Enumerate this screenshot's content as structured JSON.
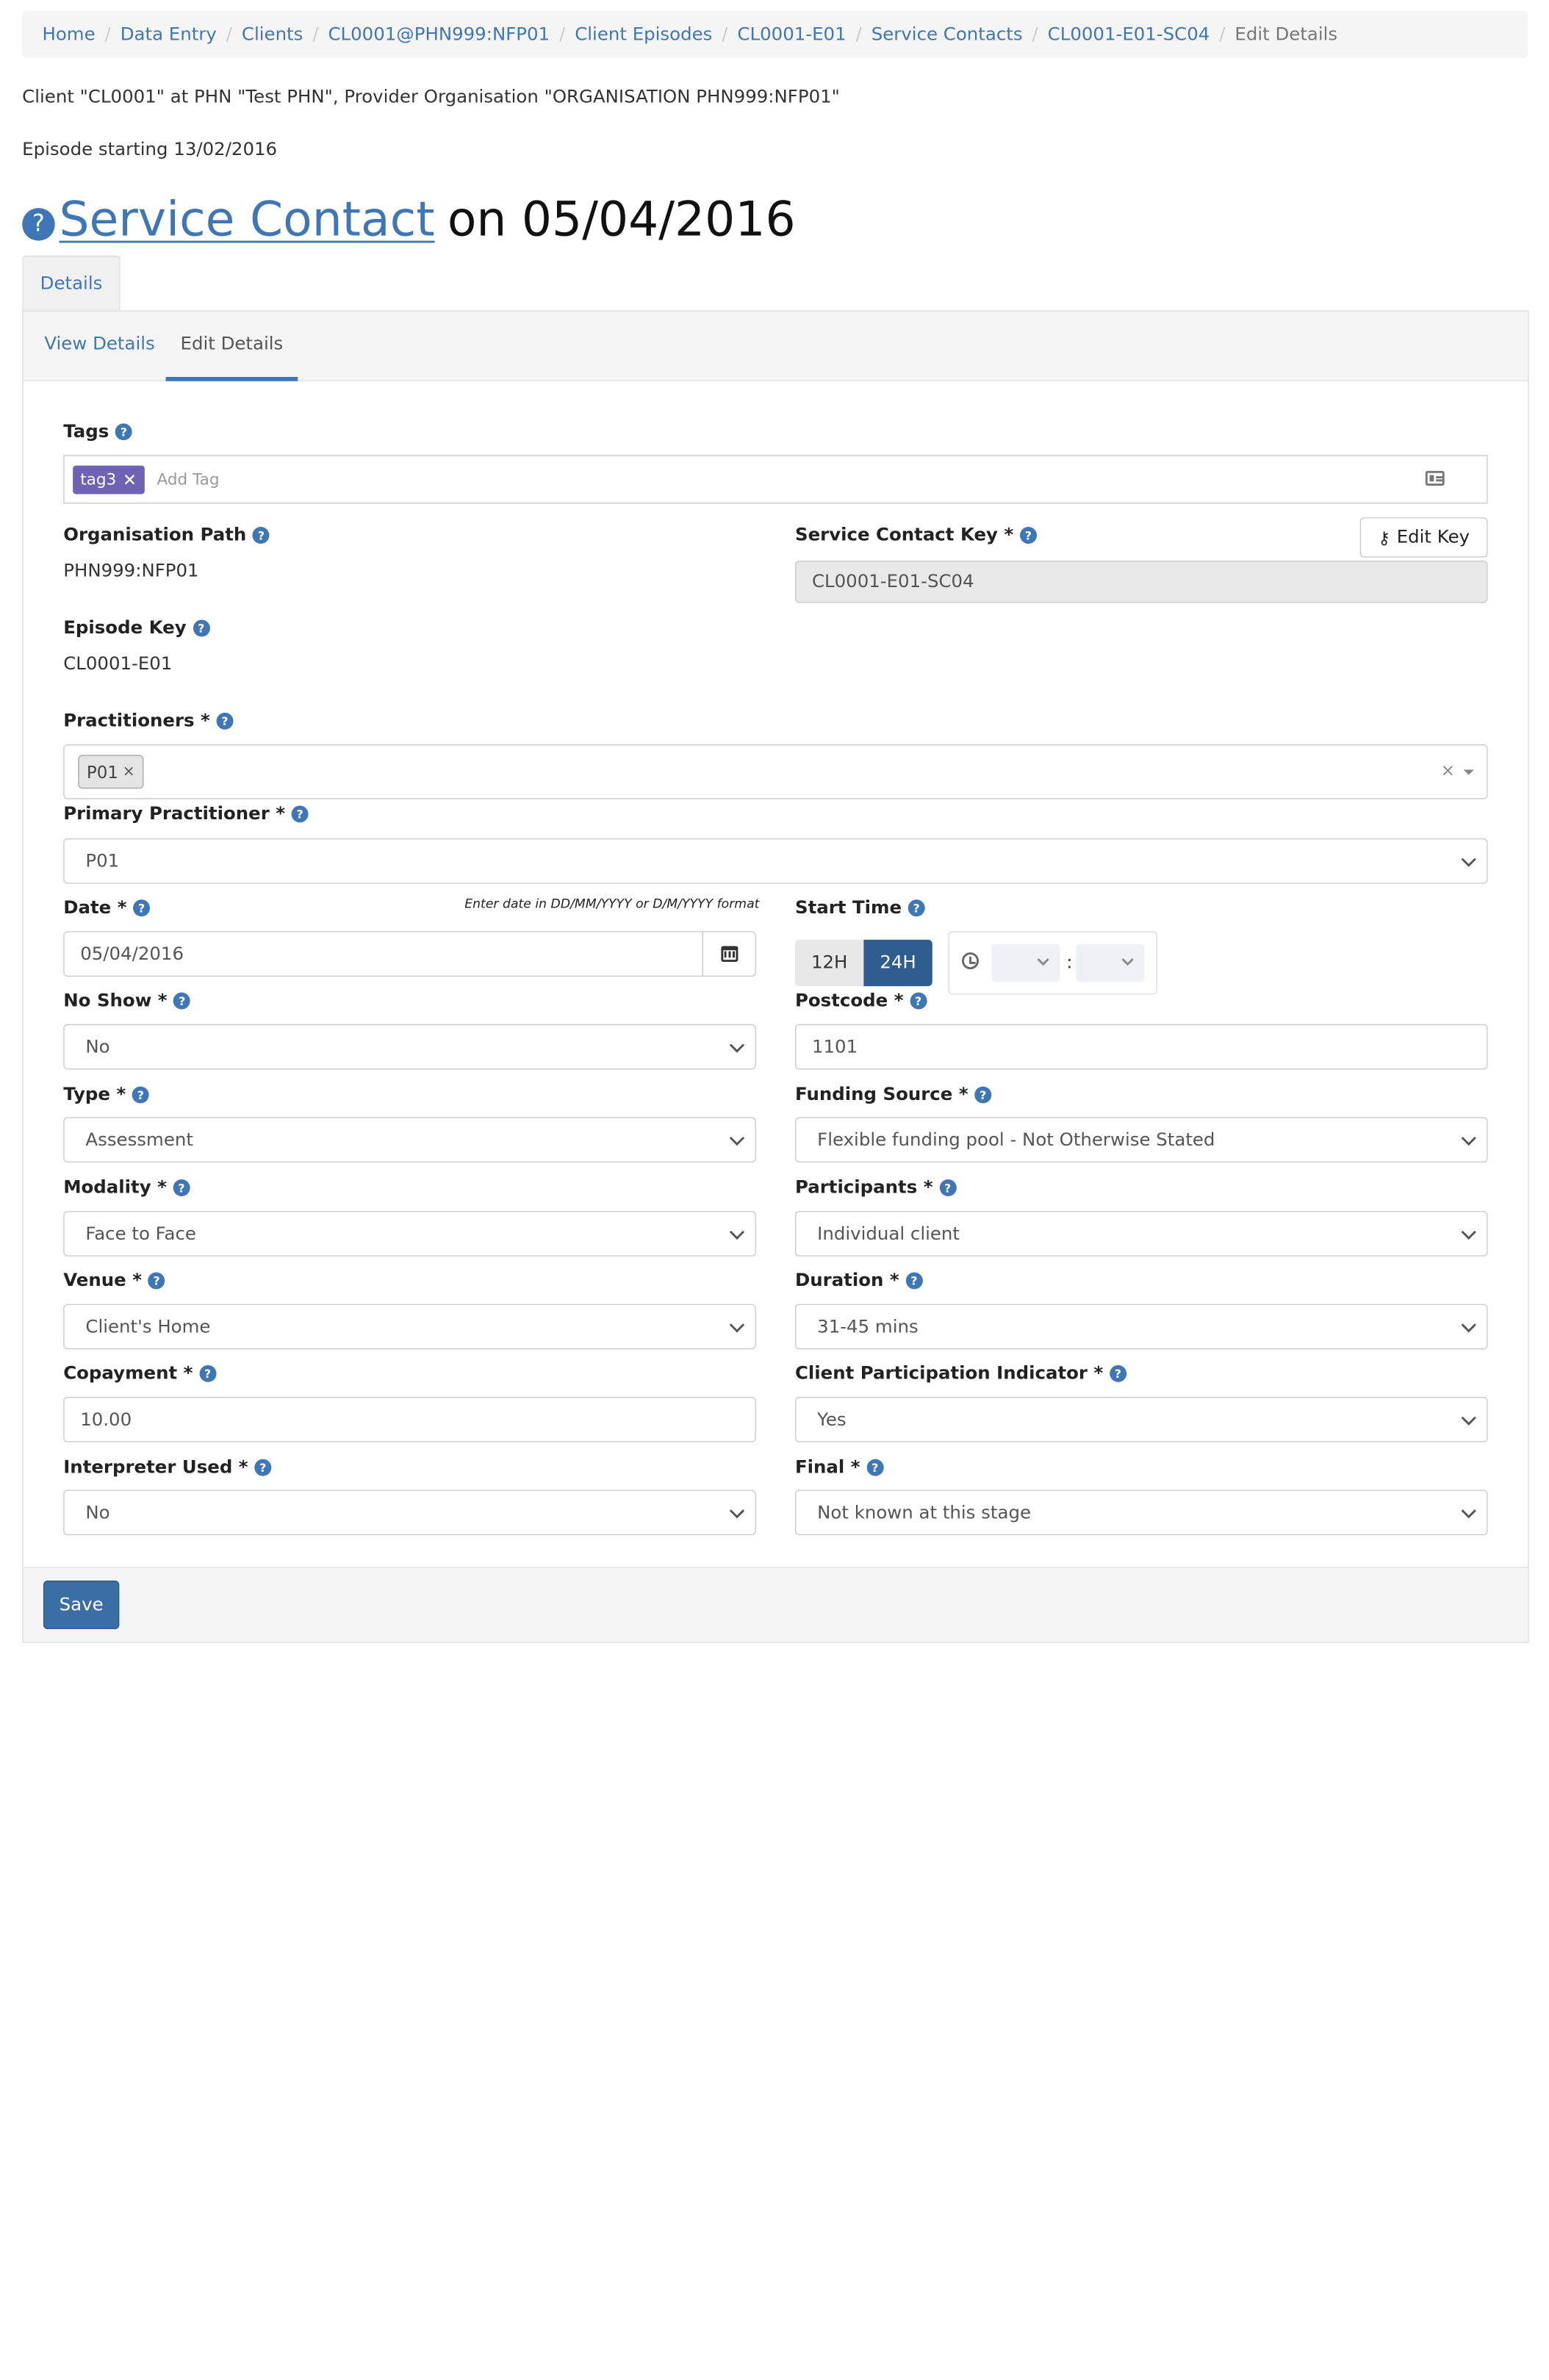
{
  "breadcrumb": [
    "Home",
    "Data Entry",
    "Clients",
    "CL0001@PHN999:NFP01",
    "Client Episodes",
    "CL0001-E01",
    "Service Contacts",
    "CL0001-E01-SC04",
    "Edit Details"
  ],
  "client_line": "Client \"CL0001\" at PHN \"Test PHN\", Provider Organisation \"ORGANISATION PHN999:NFP01\"",
  "episode_line": "Episode starting 13/02/2016",
  "title": {
    "link": "Service Contact",
    "rest": "on 05/04/2016",
    "help": "?"
  },
  "tabs": {
    "outer": "Details",
    "view": "View Details",
    "edit": "Edit Details"
  },
  "help_glyph": "?",
  "form": {
    "tags": {
      "label": "Tags",
      "chips": [
        "tag3"
      ],
      "placeholder": "Add Tag",
      "remove": "✕"
    },
    "org_path": {
      "label": "Organisation Path",
      "value": "PHN999:NFP01"
    },
    "service_contact_key": {
      "label": "Service Contact Key *",
      "value": "CL0001-E01-SC04",
      "edit_button": "Edit Key"
    },
    "episode_key": {
      "label": "Episode Key",
      "value": "CL0001-E01"
    },
    "practitioners": {
      "label": "Practitioners *",
      "chips": [
        "P01"
      ],
      "chip_remove": "×",
      "clear": "×"
    },
    "primary_practitioner": {
      "label": "Primary Practitioner *",
      "value": "P01"
    },
    "date": {
      "label": "Date *",
      "hint": "Enter date in DD/MM/YYYY or D/M/YYYY format",
      "value": "05/04/2016"
    },
    "start_time": {
      "label": "Start Time",
      "h12": "12H",
      "h24": "24H",
      "mode": "24H",
      "separator": ":"
    },
    "no_show": {
      "label": "No Show *",
      "value": "No"
    },
    "postcode": {
      "label": "Postcode *",
      "value": "1101"
    },
    "type": {
      "label": "Type *",
      "value": "Assessment"
    },
    "funding_source": {
      "label": "Funding Source *",
      "value": "Flexible funding pool - Not Otherwise Stated"
    },
    "modality": {
      "label": "Modality *",
      "value": "Face to Face"
    },
    "participants": {
      "label": "Participants *",
      "value": "Individual client"
    },
    "venue": {
      "label": "Venue *",
      "value": "Client's Home"
    },
    "duration": {
      "label": "Duration *",
      "value": "31-45 mins"
    },
    "copayment": {
      "label": "Copayment *",
      "value": "10.00"
    },
    "client_participation": {
      "label": "Client Participation Indicator *",
      "value": "Yes"
    },
    "interpreter": {
      "label": "Interpreter Used *",
      "value": "No"
    },
    "final": {
      "label": "Final *",
      "value": "Not known at this stage"
    }
  },
  "save_label": "Save",
  "colors": {
    "link": "#3f76b5",
    "primary": "#3a6ea5",
    "tag": "#6e62b5",
    "active_toggle": "#2f5d8f"
  }
}
